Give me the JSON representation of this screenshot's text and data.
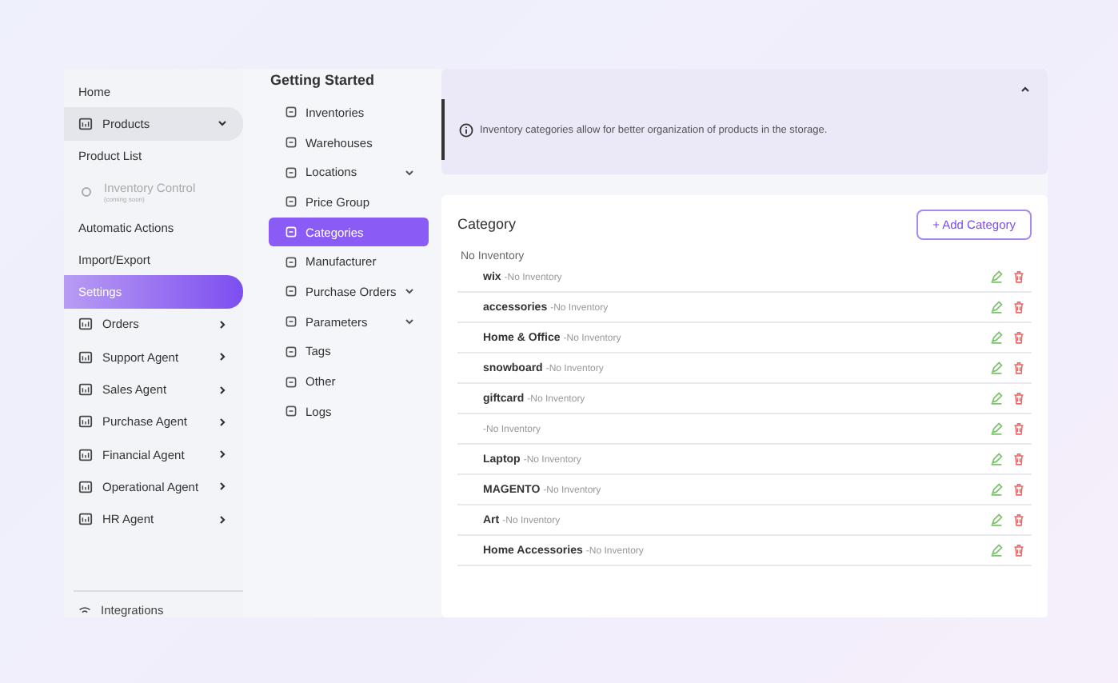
{
  "sidebar": {
    "items": [
      {
        "kind": "link",
        "label": "Home",
        "selected": false
      },
      {
        "kind": "group",
        "label": "Products",
        "selected": false,
        "expanded": true
      },
      {
        "kind": "link",
        "label": "Product List",
        "selected": false
      },
      {
        "kind": "sub",
        "label": "Inventory Control",
        "subtitle": "(coming soon)",
        "selected": false,
        "disabled": true
      },
      {
        "kind": "link",
        "label": "Automatic Actions",
        "selected": false
      },
      {
        "kind": "link",
        "label": "Import/Export",
        "selected": false
      },
      {
        "kind": "link",
        "label": "Settings",
        "selected": true
      },
      {
        "kind": "group",
        "label": "Orders",
        "selected": false,
        "expanded": false
      },
      {
        "kind": "group",
        "label": "Support Agent",
        "selected": false,
        "expanded": false
      },
      {
        "kind": "group",
        "label": "Sales Agent",
        "selected": false,
        "expanded": false
      },
      {
        "kind": "group",
        "label": "Purchase Agent",
        "selected": false,
        "expanded": false
      },
      {
        "kind": "group",
        "label": "Financial Agent",
        "selected": false,
        "expanded": false
      },
      {
        "kind": "group",
        "label": "Operational Agent",
        "selected": false,
        "expanded": false
      },
      {
        "kind": "group",
        "label": "HR Agent",
        "selected": false,
        "expanded": false
      }
    ],
    "footer": "Integrations"
  },
  "settings_nav": {
    "title": "Getting Started",
    "items": [
      {
        "kind": "link",
        "label": "Inventories",
        "selected": false
      },
      {
        "kind": "link",
        "label": "Warehouses",
        "selected": false
      },
      {
        "kind": "menu",
        "label": "Locations",
        "selected": false
      },
      {
        "kind": "link",
        "label": "Price Group",
        "selected": false
      },
      {
        "kind": "link",
        "label": "Categories",
        "selected": true
      },
      {
        "kind": "link",
        "label": "Manufacturer",
        "selected": false
      },
      {
        "kind": "menu",
        "label": "Purchase Orders",
        "selected": false
      },
      {
        "kind": "menu",
        "label": "Parameters",
        "selected": false
      },
      {
        "kind": "link",
        "label": "Tags",
        "selected": false
      },
      {
        "kind": "link",
        "label": "Other",
        "selected": false
      },
      {
        "kind": "link",
        "label": "Logs",
        "selected": false
      }
    ]
  },
  "info_banner": {
    "text": "Inventory categories allow for better organization of products in the storage.",
    "expanded": true
  },
  "category_panel": {
    "title": "Category",
    "add_button": "+ Add Category",
    "group_label": "No Inventory",
    "rows": [
      {
        "name": "wix",
        "note": "-No Inventory"
      },
      {
        "name": "accessories",
        "note": "-No Inventory"
      },
      {
        "name": "Home & Office",
        "note": "-No Inventory"
      },
      {
        "name": "snowboard",
        "note": "-No Inventory"
      },
      {
        "name": "giftcard",
        "note": "-No Inventory"
      },
      {
        "note": "-No Inventory"
      },
      {
        "name": "Laptop",
        "note": "-No Inventory"
      },
      {
        "name": "MAGENTO",
        "note": "-No Inventory"
      },
      {
        "name": "Art",
        "note": "-No Inventory"
      },
      {
        "name": "Home Accessories",
        "note": "-No Inventory"
      }
    ]
  }
}
